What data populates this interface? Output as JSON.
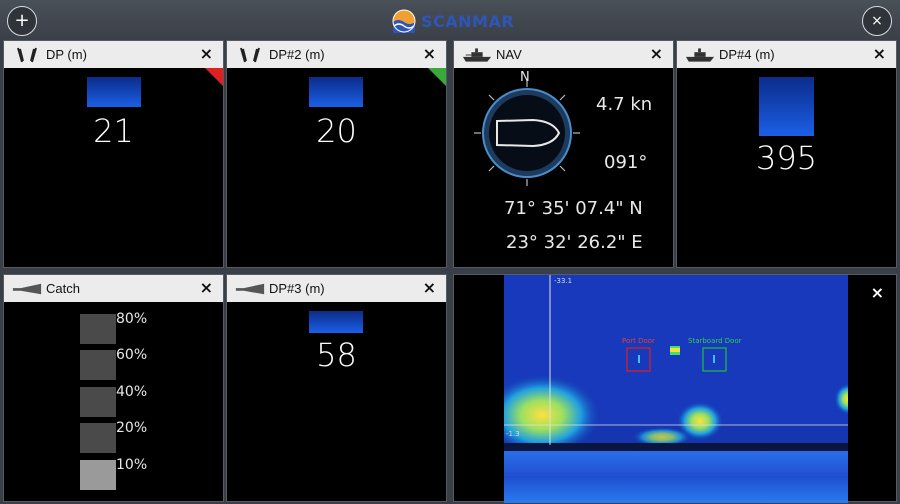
{
  "app": {
    "brand": "SCANMAR"
  },
  "colors": {
    "brand": "#2e55b8",
    "depth_bar": "#1b5fe6",
    "flag_red": "#e02020",
    "flag_green": "#3aa83a",
    "panel_bg": "#000000"
  },
  "topbar": {
    "add_label": "+",
    "close_label": "×"
  },
  "panels": {
    "dp1": {
      "title": "DP (m)",
      "value": "21",
      "icon": "trawl-door-icon",
      "close": "×",
      "flag": "red"
    },
    "dp2": {
      "title": "DP#2 (m)",
      "value": "20",
      "icon": "trawl-door-icon",
      "close": "×",
      "flag": "green"
    },
    "nav": {
      "title": "NAV",
      "icon": "ship-icon",
      "close": "×",
      "north": "N",
      "speed": "4.7 kn",
      "heading": "091°",
      "lat": "71° 35' 07.4\" N",
      "lon": "23° 32' 26.2\" E"
    },
    "dp4": {
      "title": "DP#4 (m)",
      "value": "395",
      "icon": "ship-icon",
      "close": "×"
    },
    "catch": {
      "title": "Catch",
      "icon": "trawl-net-icon",
      "close": "×",
      "levels": [
        {
          "label": "80%",
          "filled": false
        },
        {
          "label": "60%",
          "filled": false
        },
        {
          "label": "40%",
          "filled": false
        },
        {
          "label": "20%",
          "filled": false
        },
        {
          "label": "10%",
          "filled": true
        }
      ]
    },
    "dp3": {
      "title": "DP#3 (m)",
      "value": "58",
      "icon": "trawl-net-icon",
      "close": "×"
    },
    "sonar": {
      "close": "×",
      "depth_top": "-33.1",
      "depth_side": "-1.3",
      "port_door": "Port Door",
      "starboard_door": "Starboard Door"
    }
  }
}
